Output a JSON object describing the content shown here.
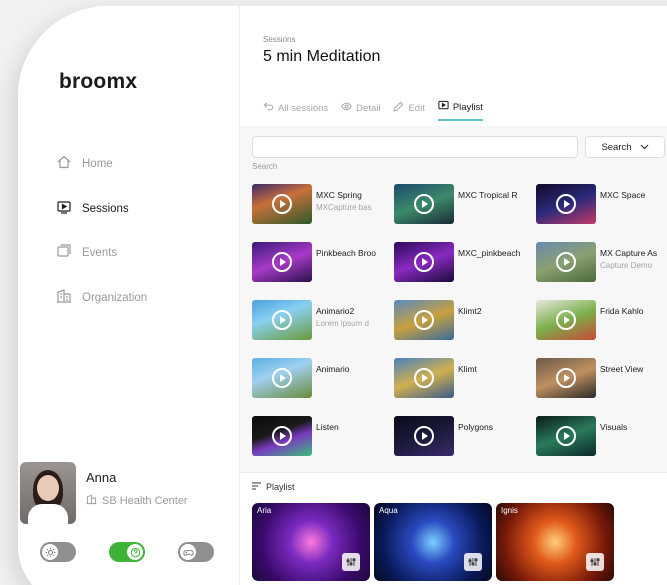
{
  "brand": "broomx",
  "nav": [
    {
      "label": "Home",
      "icon": "home-icon"
    },
    {
      "label": "Sessions",
      "icon": "sessions-icon",
      "active": true
    },
    {
      "label": "Events",
      "icon": "events-icon"
    },
    {
      "label": "Organization",
      "icon": "organization-icon"
    }
  ],
  "user": {
    "name": "Anna",
    "org": "SB Health Center"
  },
  "toggles": [
    {
      "icon": "sun-icon",
      "state": "off"
    },
    {
      "icon": "help-icon",
      "state": "on"
    },
    {
      "icon": "gamepad-icon",
      "state": "off"
    }
  ],
  "header": {
    "crumb": "Sessions",
    "title": "5 min Meditation"
  },
  "tabs": [
    {
      "label": "All sessions",
      "icon": "back-arrow-icon"
    },
    {
      "label": "Detail",
      "icon": "eye-icon"
    },
    {
      "label": "Edit",
      "icon": "pencil-icon"
    },
    {
      "label": "Playlist",
      "icon": "playlist-icon",
      "active": true
    }
  ],
  "search": {
    "button": "Search",
    "label": "Search",
    "placeholder": ""
  },
  "sessions": [
    {
      "name": "MXC Spring",
      "sub": "MXCapture bas"
    },
    {
      "name": "MXC Tropical R",
      "sub": ""
    },
    {
      "name": "MXC Space",
      "sub": ""
    },
    {
      "name": "Pinkbeach Broo",
      "sub": ""
    },
    {
      "name": "MXC_pinkbeach",
      "sub": ""
    },
    {
      "name": "MX Capture As",
      "sub": "Capture Demo"
    },
    {
      "name": "Animario2",
      "sub": "Lorem ipsum d"
    },
    {
      "name": "Klimt2",
      "sub": ""
    },
    {
      "name": "Frida Kahlo",
      "sub": ""
    },
    {
      "name": "Animario",
      "sub": ""
    },
    {
      "name": "Klimt",
      "sub": ""
    },
    {
      "name": "Street View",
      "sub": ""
    },
    {
      "name": "Listen",
      "sub": ""
    },
    {
      "name": "Polygons",
      "sub": ""
    },
    {
      "name": "Visuals",
      "sub": ""
    }
  ],
  "playlist": {
    "title": "Playlist",
    "items": [
      {
        "name": "Aria"
      },
      {
        "name": "Aqua"
      },
      {
        "name": "Ignis"
      }
    ]
  },
  "colors": {
    "accent": "#5ec0c2",
    "toggle_on": "#3eb337"
  }
}
